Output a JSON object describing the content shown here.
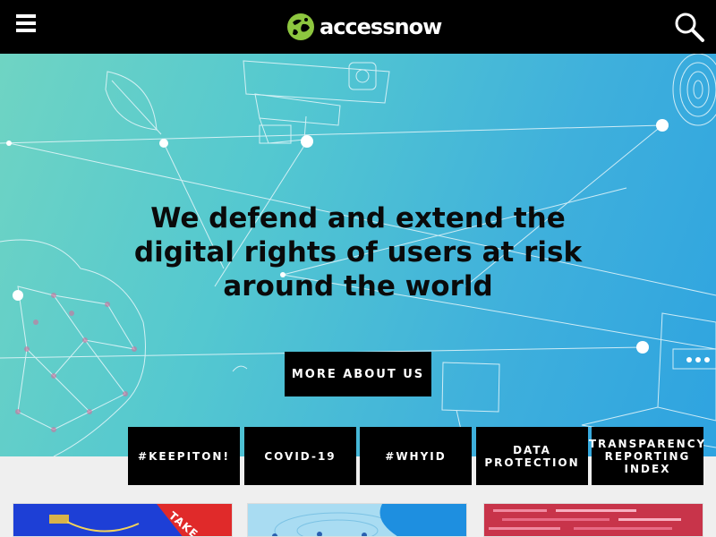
{
  "header": {
    "brand": "accessnow",
    "menu_icon": "hamburger-menu-icon",
    "search_icon": "search-icon",
    "logo_color": "#8dc63f"
  },
  "hero": {
    "headline": "We defend and extend the digital rights of users at risk around the world",
    "cta_label": "MORE ABOUT US",
    "gradient": [
      "#6fd4c3",
      "#2ea3e0"
    ]
  },
  "tags": [
    {
      "label": "#KEEPITON!"
    },
    {
      "label": "COVID-19"
    },
    {
      "label": "#WHYID"
    },
    {
      "label": "DATA PROTECTION"
    },
    {
      "label": "TRANSPARENCY REPORTING INDEX"
    }
  ],
  "cards": [
    {
      "ribbon": "TAKE"
    },
    {
      "name": "network-card"
    },
    {
      "name": "code-card"
    }
  ]
}
